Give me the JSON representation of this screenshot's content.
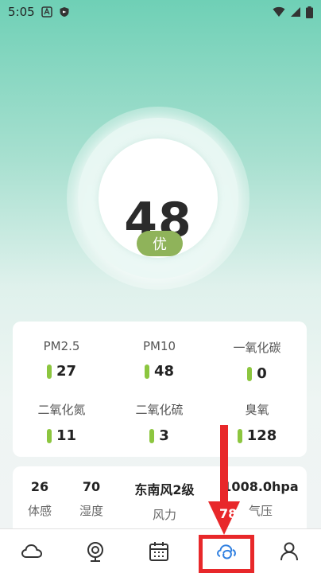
{
  "status_bar": {
    "time": "5:05",
    "icons": [
      "notification-a-icon",
      "shield-icon",
      "wifi-icon",
      "signal-icon",
      "battery-icon"
    ]
  },
  "aqi": {
    "value": "48",
    "level": "优"
  },
  "pollutants": [
    {
      "label": "PM2.5",
      "value": "27"
    },
    {
      "label": "PM10",
      "value": "48"
    },
    {
      "label": "一氧化碳",
      "value": "0"
    },
    {
      "label": "二氧化氮",
      "value": "11"
    },
    {
      "label": "二氧化硫",
      "value": "3"
    },
    {
      "label": "臭氧",
      "value": "128"
    }
  ],
  "weather": [
    {
      "value": "26",
      "label": "体感"
    },
    {
      "value": "70",
      "label": "湿度"
    },
    {
      "value": "东南风2级",
      "label": "风力"
    },
    {
      "value": "1008.0hpa",
      "label": "气压"
    }
  ],
  "obscured_value": "78",
  "nav": {
    "items": [
      "weather-cloud-icon",
      "camera-icon",
      "calendar-icon",
      "air-quality-icon",
      "profile-icon"
    ],
    "active_index": 3
  },
  "colors": {
    "accent": "#8cc63f",
    "level_badge": "#8fb35a",
    "active_nav": "#2f7fe0",
    "annotation": "#e8282a"
  }
}
